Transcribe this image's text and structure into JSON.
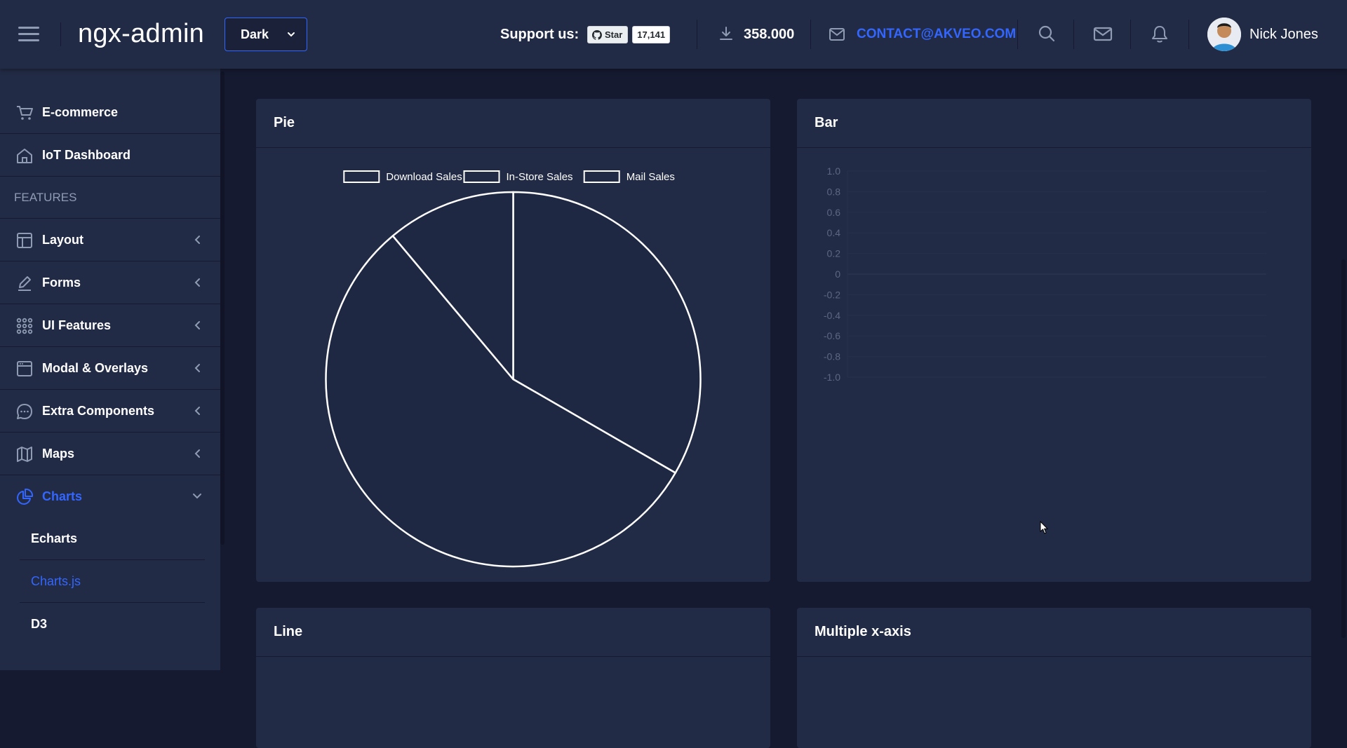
{
  "header": {
    "logo": "ngx-admin",
    "theme": "Dark",
    "support_label": "Support us:",
    "github_star_label": "Star",
    "github_star_count": "17,141",
    "downloads": "358.000",
    "contact_email": "CONTACT@AKVEO.COM",
    "user_name": "Nick Jones"
  },
  "sidebar": {
    "items_top": [
      {
        "label": "E-commerce",
        "icon": "shopping-cart-icon"
      },
      {
        "label": "IoT Dashboard",
        "icon": "home-icon"
      }
    ],
    "section_title": "FEATURES",
    "items": [
      {
        "label": "Layout",
        "icon": "layout-icon"
      },
      {
        "label": "Forms",
        "icon": "edit-icon"
      },
      {
        "label": "UI Features",
        "icon": "keypad-icon"
      },
      {
        "label": "Modal & Overlays",
        "icon": "browser-icon"
      },
      {
        "label": "Extra Components",
        "icon": "message-circle-icon"
      },
      {
        "label": "Maps",
        "icon": "map-icon"
      }
    ],
    "charts_label": "Charts",
    "charts_subitems": [
      "Echarts",
      "Charts.js",
      "D3"
    ],
    "active_subitem": "Charts.js"
  },
  "cards": {
    "pie_title": "Pie",
    "bar_title": "Bar",
    "line_title": "Line",
    "multi_title": "Multiple x-axis"
  },
  "chart_data": [
    {
      "type": "pie",
      "legend": [
        "Download Sales",
        "In-Store Sales",
        "Mail Sales"
      ],
      "values": [
        300,
        500,
        100
      ],
      "legend_position": "top"
    },
    {
      "type": "bar",
      "yticks": [
        "1.0",
        "0.8",
        "0.6",
        "0.4",
        "0.2",
        "0",
        "-0.2",
        "-0.4",
        "-0.6",
        "-0.8",
        "-1.0"
      ],
      "ylim": [
        -1.0,
        1.0
      ],
      "grid": true,
      "series": []
    }
  ]
}
